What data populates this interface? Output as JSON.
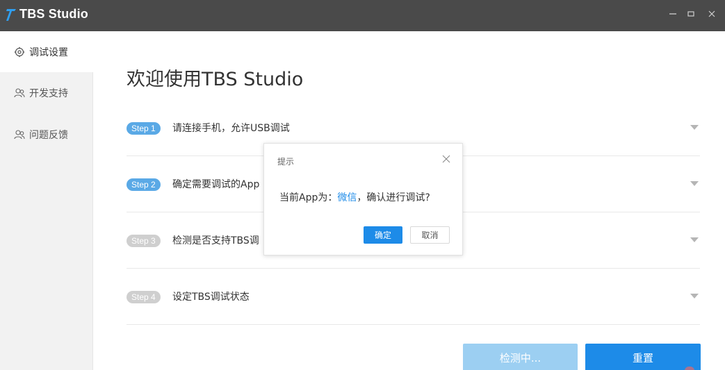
{
  "window": {
    "title": "TBS Studio",
    "controls": {
      "minimize": "–",
      "maximize": "▢",
      "close": "✕"
    },
    "accent": "#1d8be8"
  },
  "sidebar": {
    "items": [
      {
        "label": "调试设置",
        "icon": "gear-icon",
        "active": true
      },
      {
        "label": "开发支持",
        "icon": "users-icon",
        "active": false
      },
      {
        "label": "问题反馈",
        "icon": "users-icon",
        "active": false
      }
    ]
  },
  "main": {
    "title": "欢迎使用TBS Studio",
    "steps": [
      {
        "badge": "Step 1",
        "text": "请连接手机，允许USB调试",
        "active": true
      },
      {
        "badge": "Step 2",
        "text": "确定需要调试的App",
        "active": true
      },
      {
        "badge": "Step 3",
        "text": "检测是否支持TBS调",
        "active": false
      },
      {
        "badge": "Step 4",
        "text": "设定TBS调试状态",
        "active": false
      }
    ],
    "buttons": {
      "detect": "检测中...",
      "reset": "重置"
    }
  },
  "dialog": {
    "title": "提示",
    "message_prefix": "当前App为：",
    "message_app": "微信",
    "message_suffix": "，确认进行调试?",
    "ok": "确定",
    "cancel": "取消"
  }
}
